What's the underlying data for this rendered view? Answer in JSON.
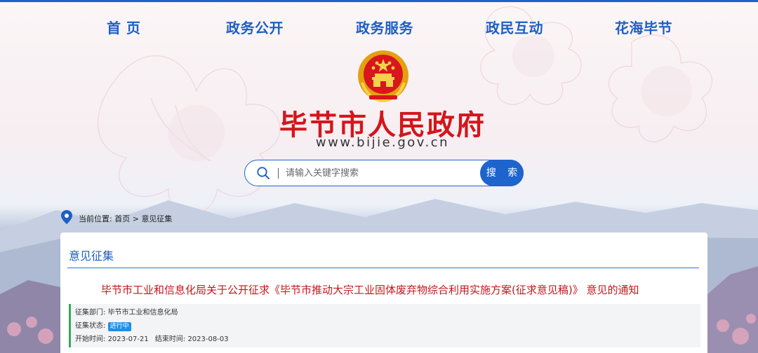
{
  "nav": {
    "items": [
      {
        "label": "首  页"
      },
      {
        "label": "政务公开"
      },
      {
        "label": "政务服务"
      },
      {
        "label": "政民互动"
      },
      {
        "label": "花海毕节"
      }
    ]
  },
  "header": {
    "title": "毕节市人民政府",
    "url": "www.bijie.gov.cn",
    "emblem_icon": "national-emblem-icon"
  },
  "search": {
    "placeholder": "请输入关键字搜索",
    "value": "",
    "button_label": "搜 索"
  },
  "breadcrumb": {
    "prefix": "当前位置:",
    "home": "首页",
    "separator": ">",
    "current": "意见征集"
  },
  "panel": {
    "title": "意见征集",
    "notice_title": "毕节市工业和信息化局关于公开征求《毕节市推动大宗工业固体废弃物综合利用实施方案(征求意见稿)》 意见的通知",
    "department_label": "征集部门:",
    "department": "毕节市工业和信息化局",
    "status_label": "征集状态:",
    "status": "进行中",
    "start_label": "开始时间:",
    "start_date": "2023-07-21",
    "end_label": "结束时间:",
    "end_date": "2023-08-03"
  },
  "colors": {
    "accent": "#1d5fc4",
    "title_red": "#d3161b",
    "status_badge": "#1e8fe6",
    "info_border": "#3aa55f"
  }
}
